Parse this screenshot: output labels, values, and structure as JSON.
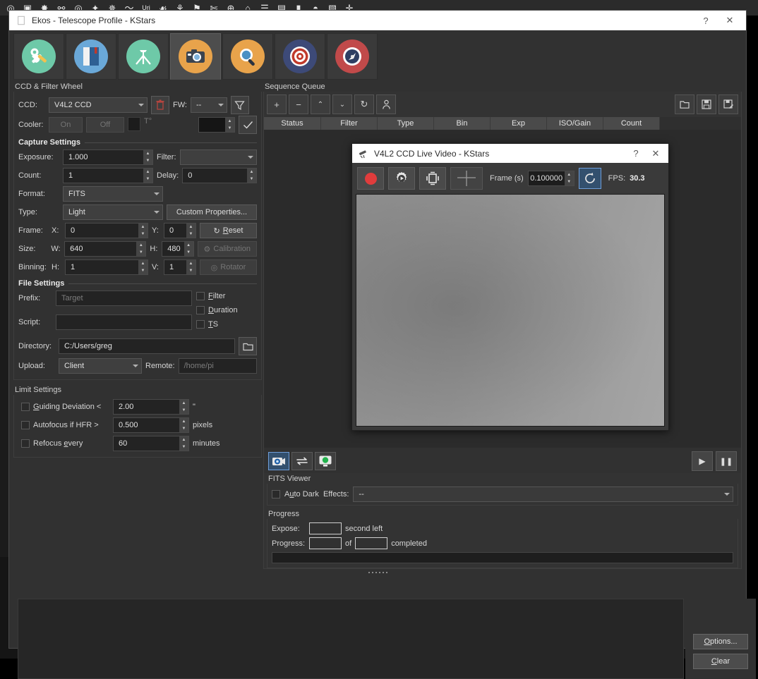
{
  "kstars_toolbar": {
    "icons": [
      "target-icon",
      "image-icon",
      "sun-icon",
      "ellipse-icon",
      "galaxy-icon",
      "star-icon",
      "comet-icon",
      "curve-icon",
      "uranus-label-icon",
      "rabbit-icon",
      "constellation-icon",
      "flag-icon",
      "xcross-icon",
      "globe-grid-icon",
      "dome-icon",
      "list-icon",
      "fridge-icon",
      "torch-icon",
      "moon-icon",
      "export-icon",
      "crosshair-icon"
    ]
  },
  "window": {
    "title": "Ekos - Telescope Profile - KStars",
    "help_label": "?",
    "close_label": "✕",
    "titlebar_icon": "document-icon"
  },
  "module_tabs": [
    {
      "name": "setup",
      "icon": "wrench-icon",
      "active": false,
      "bg": "#6ec9a8"
    },
    {
      "name": "scheduler",
      "icon": "book-icon",
      "active": false,
      "bg": "#6aa8d8"
    },
    {
      "name": "mount",
      "icon": "tripod-icon",
      "active": false,
      "bg": "#6ec9a8"
    },
    {
      "name": "ccd",
      "icon": "camera-icon",
      "active": true,
      "bg": "#e8a34b"
    },
    {
      "name": "focus",
      "icon": "magnifier-icon",
      "active": false,
      "bg": "#e8a34b"
    },
    {
      "name": "align",
      "icon": "target-icon",
      "active": false,
      "bg": "#3d4a78"
    },
    {
      "name": "guide",
      "icon": "compass-icon",
      "active": false,
      "bg": "#c14a4a"
    }
  ],
  "ccd_panel": {
    "group_title": "CCD & Filter Wheel",
    "ccd_label": "CCD:",
    "ccd_value": "V4L2 CCD",
    "remove_icon": "trash-icon",
    "fw_label": "FW:",
    "fw_value": "--",
    "filter_icon": "funnel-icon",
    "cooler_label": "Cooler:",
    "cooler_on": "On",
    "cooler_off": "Off",
    "cooler_temp_label": "T°",
    "temp_value": "",
    "check_icon": "check-icon"
  },
  "capture_settings": {
    "heading": "Capture Settings",
    "exposure_label": "Exposure:",
    "exposure_value": "1.000",
    "filter_label": "Filter:",
    "filter_value": "",
    "count_label": "Count:",
    "count_value": "1",
    "delay_label": "Delay:",
    "delay_value": "0",
    "format_label": "Format:",
    "format_value": "FITS",
    "type_label": "Type:",
    "type_value": "Light",
    "custom_properties_label": "Custom Properties...",
    "frame_label": "Frame:",
    "frame_x_label": "X:",
    "frame_x_value": "0",
    "frame_y_label": "Y:",
    "frame_y_value": "0",
    "reset_label": "Reset",
    "reset_icon": "refresh-icon",
    "size_label": "Size:",
    "size_w_label": "W:",
    "size_w_value": "640",
    "size_h_label": "H:",
    "size_h_value": "480",
    "calibration_label": "Calibration",
    "calibration_icon": "gear-icon",
    "binning_label": "Binning:",
    "binning_h_label": "H:",
    "binning_h_value": "1",
    "binning_v_label": "V:",
    "binning_v_value": "1",
    "rotator_label": "Rotator",
    "rotator_icon": "rotator-icon"
  },
  "file_settings": {
    "heading": "File Settings",
    "prefix_label": "Prefix:",
    "prefix_placeholder": "Target",
    "prefix_value": "",
    "script_label": "Script:",
    "script_value": "",
    "filter_chk_label": "Filter",
    "duration_chk_label": "Duration",
    "ts_chk_label": "TS",
    "directory_label": "Directory:",
    "directory_value": "C:/Users/greg",
    "browse_icon": "folder-icon",
    "upload_label": "Upload:",
    "upload_value": "Client",
    "remote_label": "Remote:",
    "remote_placeholder": "/home/pi",
    "remote_value": ""
  },
  "limit_settings": {
    "heading": "Limit Settings",
    "guiding_label": "Guiding Deviation <",
    "guiding_value": "2.00",
    "guiding_unit": "\"",
    "autofocus_label": "Autofocus if HFR >",
    "autofocus_value": "0.500",
    "autofocus_unit": "pixels",
    "refocus_label": "Refocus every",
    "refocus_value": "60",
    "refocus_unit": "minutes"
  },
  "sequence_queue": {
    "group_title": "Sequence Queue",
    "toolbar": [
      {
        "name": "add-job-button",
        "icon": "plus-icon",
        "glyph": "+"
      },
      {
        "name": "remove-job-button",
        "icon": "minus-icon",
        "glyph": "−"
      },
      {
        "name": "move-up-button",
        "icon": "chevron-up-icon",
        "glyph": "˄"
      },
      {
        "name": "move-down-button",
        "icon": "chevron-down-icon",
        "glyph": "˅"
      },
      {
        "name": "reset-job-button",
        "icon": "refresh-icon",
        "glyph": "↻"
      },
      {
        "name": "observer-button",
        "icon": "person-icon",
        "glyph": "⚹"
      }
    ],
    "file_buttons": [
      {
        "name": "open-sequence-button",
        "icon": "folder-open-icon"
      },
      {
        "name": "save-sequence-button",
        "icon": "save-icon"
      },
      {
        "name": "save-as-sequence-button",
        "icon": "save-as-icon"
      }
    ],
    "columns": [
      "Status",
      "Filter",
      "Type",
      "Bin",
      "Exp",
      "ISO/Gain",
      "Count"
    ],
    "rows": []
  },
  "video_dialog": {
    "title": "V4L2 CCD Live Video - KStars",
    "titlebar_icon": "telescope-icon",
    "help_label": "?",
    "close_label": "✕",
    "record_icon": "record-icon",
    "settings_icon": "gear-play-icon",
    "crop_icon": "crop-icon",
    "crosshair_icon": "crosshair-icon",
    "frame_label": "Frame (s)",
    "frame_value": "0.100000",
    "refresh_icon": "refresh-icon",
    "fps_label": "FPS:",
    "fps_value": "30.3"
  },
  "capture_controls": {
    "buttons": [
      {
        "name": "live-video-button",
        "icon": "video-camera-icon",
        "active": true
      },
      {
        "name": "loop-button",
        "icon": "loop-arrows-icon",
        "active": false
      },
      {
        "name": "monitor-button",
        "icon": "green-monitor-icon",
        "active": false
      }
    ],
    "start_icon": "play-icon",
    "pause_icon": "pause-icon"
  },
  "fits_viewer": {
    "group_title": "FITS Viewer",
    "auto_dark_label": "Auto Dark",
    "effects_label": "Effects:",
    "effects_value": "--"
  },
  "progress": {
    "group_title": "Progress",
    "expose_label": "Expose:",
    "expose_value": "",
    "second_left_label": "second left",
    "progress_label": "Progress:",
    "progress_current": "",
    "of_label": "of",
    "progress_total": "",
    "completed_label": "completed",
    "bar_percent": 0
  },
  "bottom": {
    "options_label": "Options...",
    "clear_label": "Clear",
    "log_text": ""
  },
  "colors": {
    "accent_orange": "#e8a34b",
    "accent_green": "#6ec9a8",
    "accent_blue": "#6aa8d8",
    "accent_red": "#c14a4a",
    "selection_blue": "#33506e",
    "window_bg": "#313131",
    "field_bg": "#232323"
  }
}
